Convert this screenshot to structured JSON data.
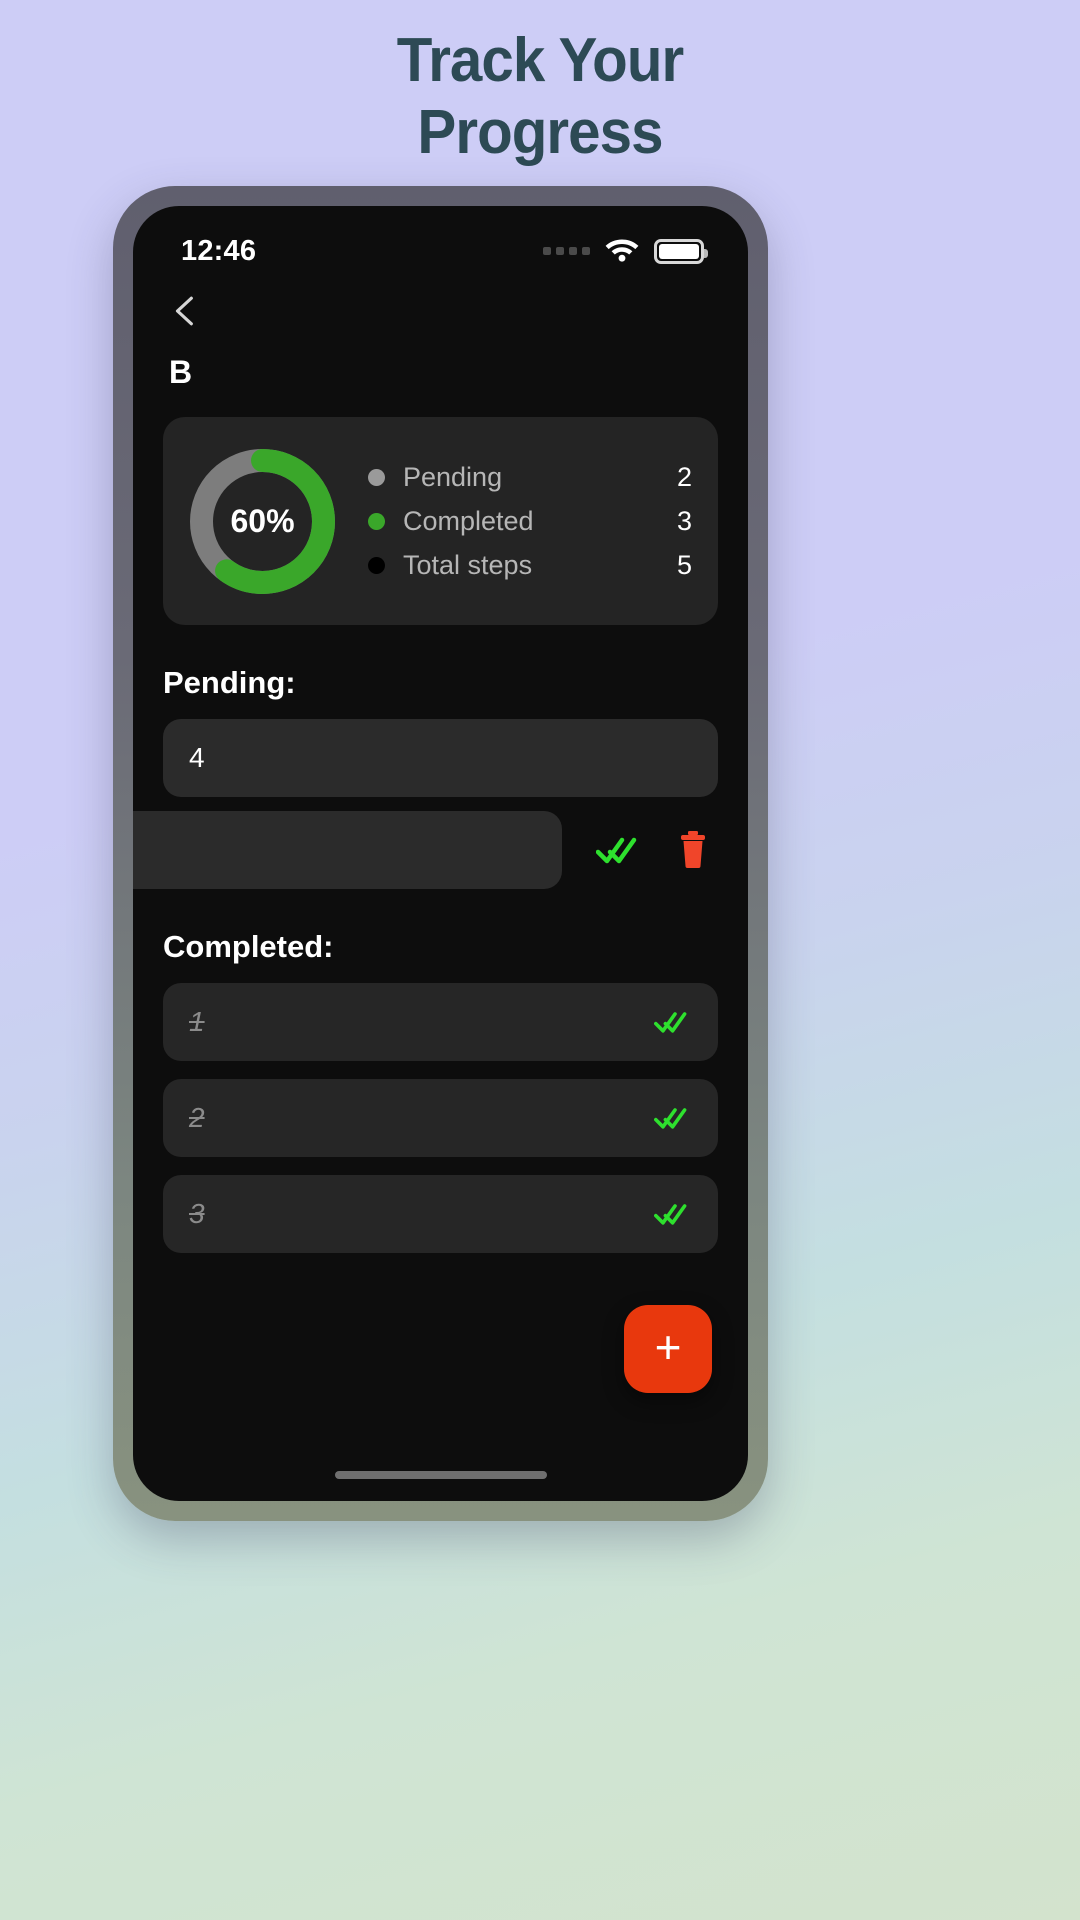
{
  "hero": {
    "line1": "Track Your",
    "line2": "Progress",
    "color": "#2d4a55"
  },
  "status_bar": {
    "time": "12:46",
    "signal_icon": "signal-dots-icon",
    "wifi_icon": "wifi-icon",
    "battery_icon": "battery-full-icon"
  },
  "nav": {
    "back_icon": "chevron-left-icon"
  },
  "screen": {
    "title": "B"
  },
  "stats": {
    "percent_label": "60%",
    "percent_value": 60,
    "ring_color": "#3aa72a",
    "ring_track_color": "#7d7d7d",
    "rows": [
      {
        "label": "Pending",
        "value": "2",
        "dot_color": "#9a9a9a"
      },
      {
        "label": "Completed",
        "value": "3",
        "dot_color": "#3aa72a"
      },
      {
        "label": "Total steps",
        "value": "5",
        "dot_color": "#000000"
      }
    ]
  },
  "pending": {
    "heading": "Pending:",
    "items": [
      {
        "text": "4",
        "check_icon": "double-check-icon",
        "delete_icon": "trash-icon"
      },
      {
        "text": "",
        "check_icon": "double-check-icon",
        "delete_icon": "trash-icon"
      }
    ]
  },
  "completed": {
    "heading": "Completed:",
    "items": [
      {
        "text": "1",
        "check_icon": "double-check-icon"
      },
      {
        "text": "2",
        "check_icon": "double-check-icon"
      },
      {
        "text": "3",
        "check_icon": "double-check-icon"
      }
    ]
  },
  "fab": {
    "label": "+",
    "color": "#e8380d",
    "icon": "plus-icon"
  },
  "colors": {
    "accent_green": "#3aa72a",
    "accent_red": "#f0452a",
    "screen_bg": "#0d0d0d",
    "card_bg": "#242424"
  }
}
